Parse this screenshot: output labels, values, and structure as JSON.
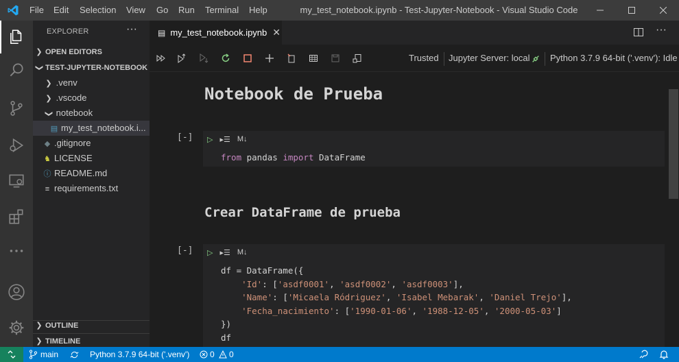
{
  "titlebar": {
    "menus": [
      "File",
      "Edit",
      "Selection",
      "View",
      "Go",
      "Run",
      "Terminal",
      "Help"
    ],
    "window_title": "my_test_notebook.ipynb - Test-Jupyter-Notebook - Visual Studio Code"
  },
  "activity_bar": [
    "explorer-icon",
    "search-icon",
    "source-control-icon",
    "run-debug-icon",
    "remote-explorer-icon",
    "extensions-icon",
    "more-icon",
    "accounts-icon",
    "manage-gear-icon"
  ],
  "sidebar": {
    "title": "EXPLORER",
    "more": "···",
    "open_editors": "OPEN EDITORS",
    "project": "TEST-JUPYTER-NOTEBOOK",
    "items": [
      {
        "label": ".venv",
        "type": "folder-collapsed"
      },
      {
        "label": ".vscode",
        "type": "folder-collapsed"
      },
      {
        "label": "notebook",
        "type": "folder-expanded"
      },
      {
        "label": "my_test_notebook.i...",
        "type": "file"
      },
      {
        "label": ".gitignore",
        "type": "file"
      },
      {
        "label": "LICENSE",
        "type": "file"
      },
      {
        "label": "README.md",
        "type": "file"
      },
      {
        "label": "requirements.txt",
        "type": "file"
      }
    ],
    "outline": "OUTLINE",
    "timeline": "TIMELINE"
  },
  "tabs": [
    {
      "label": "my_test_notebook.ipynb",
      "active": true
    }
  ],
  "notebook_toolbar": {
    "trusted": "Trusted",
    "server": "Jupyter Server: local",
    "kernel": "Python 3.7.9 64-bit ('.venv'): Idle"
  },
  "notebook": {
    "heading1": "Notebook de Prueba",
    "heading2": "Crear DataFrame de prueba",
    "cells": [
      {
        "exec": "[-]",
        "toolbar_md": "M↓"
      },
      {
        "exec": "[-]",
        "toolbar_md": "M↓"
      }
    ],
    "code1": {
      "kw1": "from",
      "mod": " pandas ",
      "kw2": "import",
      "name": " DataFrame"
    },
    "code2": {
      "l1": "df = DataFrame({",
      "l2_key": "'Id'",
      "l2_rest_open": ": [",
      "l2_vals": [
        "'asdf0001'",
        "'asdf0002'",
        "'asdf0003'"
      ],
      "l3_key": "'Name'",
      "l3_vals": [
        "'Micaela Ródriguez'",
        "'Isabel Mebarak'",
        "'Daniel Trejo'"
      ],
      "l4_key": "'Fecha_nacimiento'",
      "l4_vals": [
        "'1990-01-06'",
        "'1988-12-05'",
        "'2000-05-03'"
      ],
      "l5": "})",
      "l6": "df"
    }
  },
  "statusbar": {
    "branch": "main",
    "interpreter": "Python 3.7.9 64-bit ('.venv')",
    "errors": "0",
    "warnings": "0"
  },
  "colors": {
    "accent": "#007acc",
    "remote": "#16825d",
    "keyword": "#c586c0",
    "string": "#ce9178"
  }
}
